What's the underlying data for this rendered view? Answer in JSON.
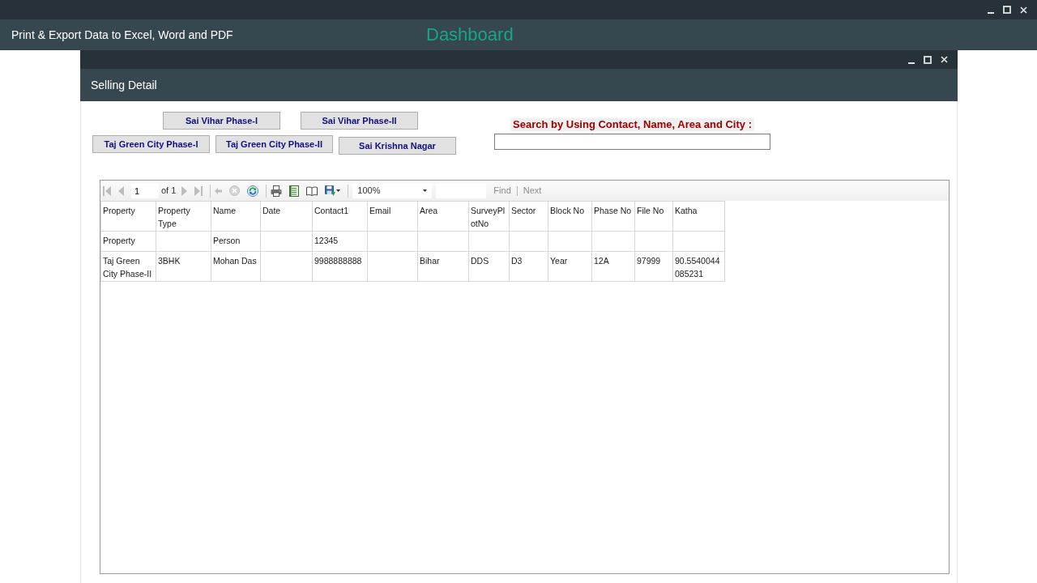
{
  "window": {
    "title": "Print & Export Data to Excel, Word and PDF",
    "heading": "Dashboard"
  },
  "child_window": {
    "title": "Selling Detail"
  },
  "filter_button_rows": [
    [
      "Sai Vihar Phase-I",
      "Sai Vihar Phase-II"
    ],
    [
      "Taj Green City Phase-I",
      "Taj Green City Phase-II",
      "Sai Krishna Nagar"
    ]
  ],
  "search": {
    "label": "Search by Using Contact, Name, Area and City :"
  },
  "report_viewer": {
    "toolbar": {
      "button_groups": [
        [
          {
            "kind": "first",
            "disabled": true
          },
          {
            "kind": "previous",
            "disabled": true
          },
          {
            "kind": "next",
            "disabled": true
          },
          {
            "kind": "last",
            "disabled": true
          }
        ],
        [
          {
            "kind": "back",
            "disabled": true
          },
          {
            "kind": "stop",
            "disabled": true
          },
          {
            "kind": "refresh",
            "disabled": false
          }
        ],
        [
          {
            "kind": "print",
            "disabled": false
          },
          {
            "kind": "print_layout",
            "disabled": false
          },
          {
            "kind": "page_setup",
            "disabled": false
          },
          {
            "kind": "export",
            "disabled": false
          }
        ]
      ],
      "page_field": {
        "value": "1"
      },
      "page_count": "of 1",
      "zoom": {
        "value": "100%"
      },
      "find_link": {
        "label": "Find",
        "disabled": true
      },
      "next_link": {
        "label": "Next",
        "disabled": true
      }
    },
    "table": {
      "columns": [
        "Property",
        "Property Type",
        "Name",
        "Date",
        "Contact1",
        "Email",
        "Area",
        "SurveyPlotNo",
        "Sector",
        "Block No",
        "Phase No",
        "File No",
        "Katha"
      ],
      "rows": [
        [
          "Property",
          null,
          "Person",
          null,
          "12345",
          null,
          null,
          null,
          null,
          null,
          null,
          null,
          null
        ],
        [
          "Taj Green City Phase-II",
          "3BHK",
          "Mohan Das",
          null,
          "9988888888",
          null,
          "Bihar",
          "DDS",
          "D3",
          "Year",
          "12A",
          "97999",
          "90.5540044085231"
        ]
      ]
    }
  }
}
